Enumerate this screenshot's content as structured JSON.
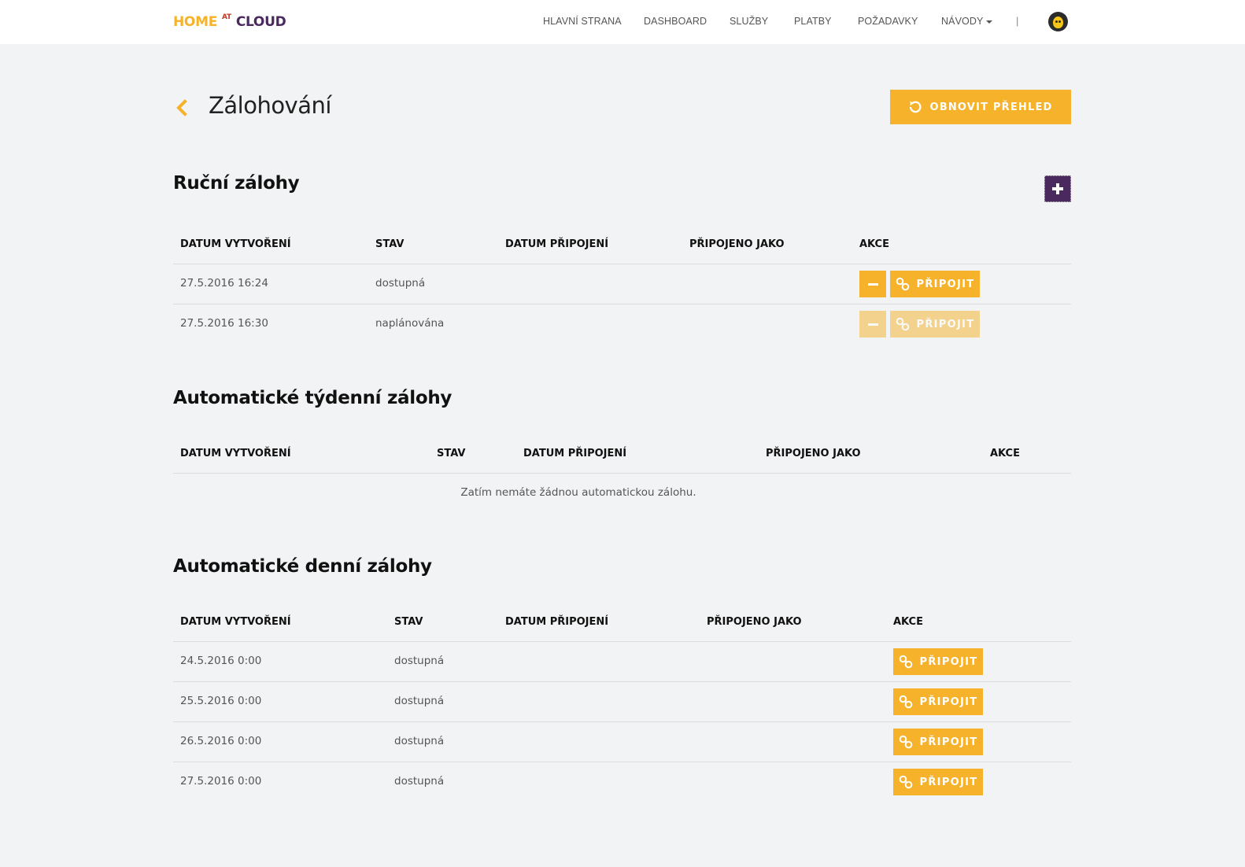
{
  "brand": {
    "home": "HOME",
    "at": "AT",
    "cloud": "CLOUD"
  },
  "nav": {
    "items": [
      "HLAVNÍ STRANA",
      "DASHBOARD",
      "SLUŽBY",
      "PLATBY",
      "POŽADAVKY"
    ],
    "dropdown_label": "NÁVODY",
    "separator": "|"
  },
  "header": {
    "title": "Zálohování",
    "refresh_label": "OBNOVIT PŘEHLED"
  },
  "manual": {
    "title": "Ruční zálohy",
    "headers": [
      "DATUM VYTVOŘENÍ",
      "STAV",
      "DATUM PŘIPOJENÍ",
      "PŘIPOJENO JAKO",
      "AKCE"
    ],
    "rows": [
      {
        "created": "27.5.2016 16:24",
        "state": "dostupná",
        "connect_label": "PŘIPOJIT",
        "enabled": true
      },
      {
        "created": "27.5.2016 16:30",
        "state": "naplánována",
        "connect_label": "PŘIPOJIT",
        "enabled": false
      }
    ]
  },
  "weekly": {
    "title": "Automatické týdenní zálohy",
    "headers": [
      "DATUM VYTVOŘENÍ",
      "STAV",
      "DATUM PŘIPOJENÍ",
      "PŘIPOJENO JAKO",
      "AKCE"
    ],
    "empty_message": "Zatím nemáte žádnou automatickou zálohu."
  },
  "daily": {
    "title": "Automatické denní zálohy",
    "headers": [
      "DATUM VYTVOŘENÍ",
      "STAV",
      "DATUM PŘIPOJENÍ",
      "PŘIPOJENO JAKO",
      "AKCE"
    ],
    "rows": [
      {
        "created": "24.5.2016 0:00",
        "state": "dostupná",
        "connect_label": "PŘIPOJIT"
      },
      {
        "created": "25.5.2016 0:00",
        "state": "dostupná",
        "connect_label": "PŘIPOJIT"
      },
      {
        "created": "26.5.2016 0:00",
        "state": "dostupná",
        "connect_label": "PŘIPOJIT"
      },
      {
        "created": "27.5.2016 0:00",
        "state": "dostupná",
        "connect_label": "PŘIPOJIT"
      }
    ]
  },
  "colors": {
    "accent": "#f5b22a",
    "brand_purple": "#4a2a5e",
    "background": "#f2f3f4"
  },
  "icons": {
    "back": "chevron-left-icon",
    "refresh": "refresh-icon",
    "add": "plus-icon",
    "remove": "minus-icon",
    "connect": "link-icon",
    "user": "avatar"
  }
}
